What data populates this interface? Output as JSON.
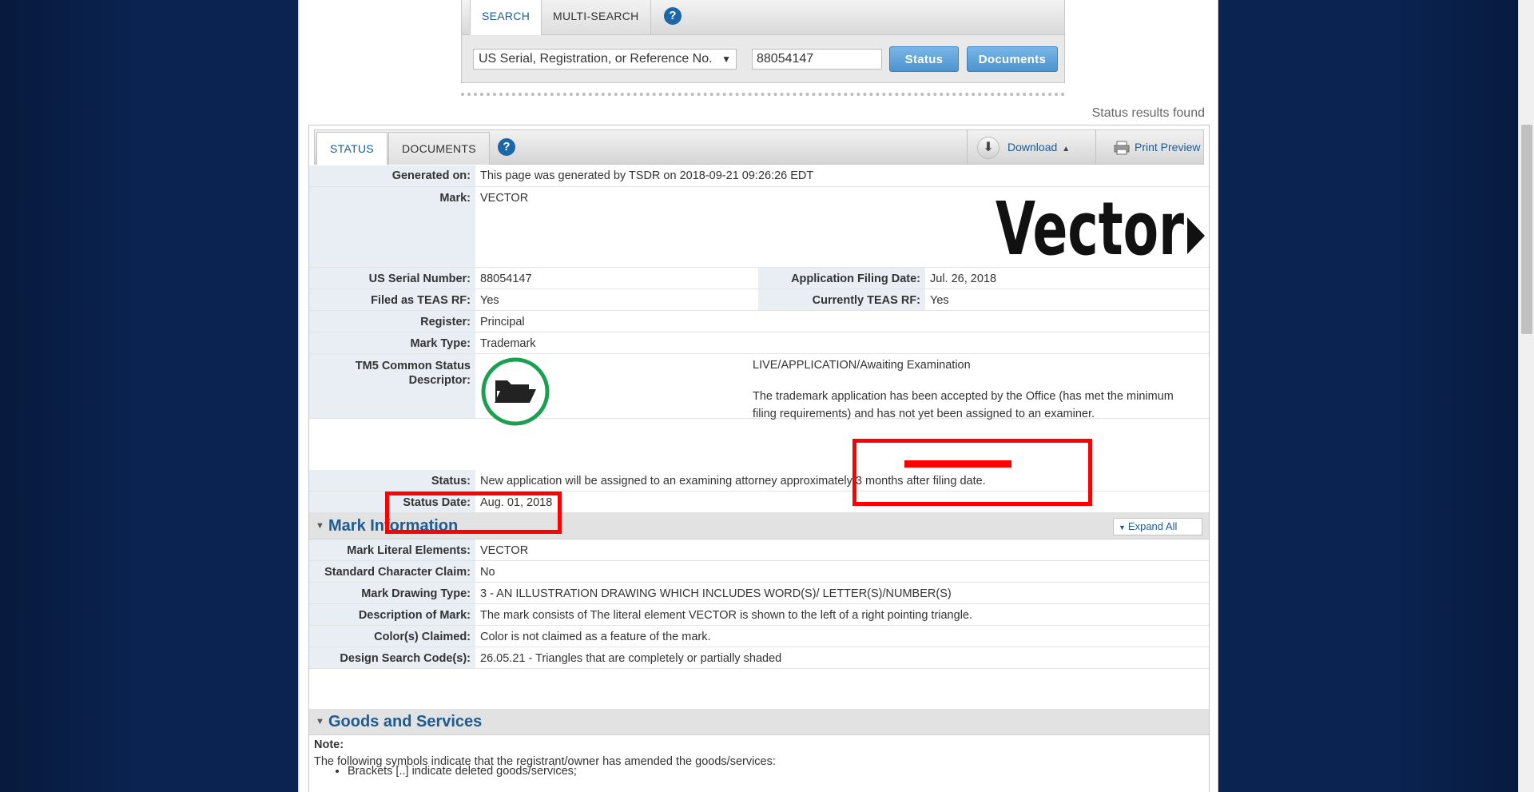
{
  "search": {
    "tabs": [
      "SEARCH",
      "MULTI-SEARCH"
    ],
    "help": "?",
    "type_select": "US Serial, Registration, or Reference No.",
    "serial_value": "88054147",
    "buttons": {
      "status": "Status",
      "documents": "Documents"
    },
    "results_found": "Status results found"
  },
  "status_tabs": [
    "STATUS",
    "DOCUMENTS"
  ],
  "toolbar": {
    "download": "Download",
    "print_preview": "Print Preview"
  },
  "fields": {
    "generated_on": {
      "label": "Generated on:",
      "value": "This page was generated by TSDR on 2018-09-21 09:26:26 EDT"
    },
    "mark": {
      "label": "Mark:",
      "value": "VECTOR",
      "logo_text": "Vector"
    },
    "serial": {
      "label": "US Serial Number:",
      "value": "88054147"
    },
    "filing_date": {
      "label": "Application Filing Date:",
      "value": "Jul. 26, 2018"
    },
    "filed_teas": {
      "label": "Filed as TEAS RF:",
      "value": "Yes"
    },
    "current_teas": {
      "label": "Currently TEAS RF:",
      "value": "Yes"
    },
    "register": {
      "label": "Register:",
      "value": "Principal"
    },
    "mark_type": {
      "label": "Mark Type:",
      "value": "Trademark"
    },
    "tm5": {
      "label_line1": "TM5 Common Status",
      "label_line2": "Descriptor:",
      "status": "LIVE/APPLICATION/Awaiting Examination",
      "description": "The trademark application has been accepted by the Office (has met the minimum filing requirements) and has not yet been assigned to an examiner."
    },
    "status": {
      "label": "Status:",
      "value": "New application will be assigned to an examining attorney approximately 3 months after filing date."
    },
    "status_date": {
      "label": "Status Date:",
      "value": "Aug. 01, 2018"
    }
  },
  "mark_info": {
    "title": "Mark Information",
    "expand_all": "Expand All",
    "rows": [
      {
        "label": "Mark Literal Elements:",
        "value": "VECTOR"
      },
      {
        "label": "Standard Character Claim:",
        "value": "No"
      },
      {
        "label": "Mark Drawing Type:",
        "value": "3 - AN ILLUSTRATION DRAWING WHICH INCLUDES WORD(S)/ LETTER(S)/NUMBER(S)"
      },
      {
        "label": "Description of Mark:",
        "value": "The mark consists of The literal element VECTOR is shown to the left of a right pointing triangle."
      },
      {
        "label": "Color(s) Claimed:",
        "value": "Color is not claimed as a feature of the mark."
      },
      {
        "label": "Design Search Code(s):",
        "value": "26.05.21 - Triangles that are completely or partially shaded"
      }
    ]
  },
  "goods": {
    "title": "Goods and Services",
    "note_label": "Note:",
    "note_text": "The following symbols indicate that the registrant/owner has amended the goods/services:",
    "bullets": [
      "Brackets [..] indicate deleted goods/services;"
    ]
  },
  "colors": {
    "annotation": "#ff0000",
    "link": "#1e5b92",
    "accent_button": "#4d93cf",
    "status_circle": "#1aa050"
  }
}
